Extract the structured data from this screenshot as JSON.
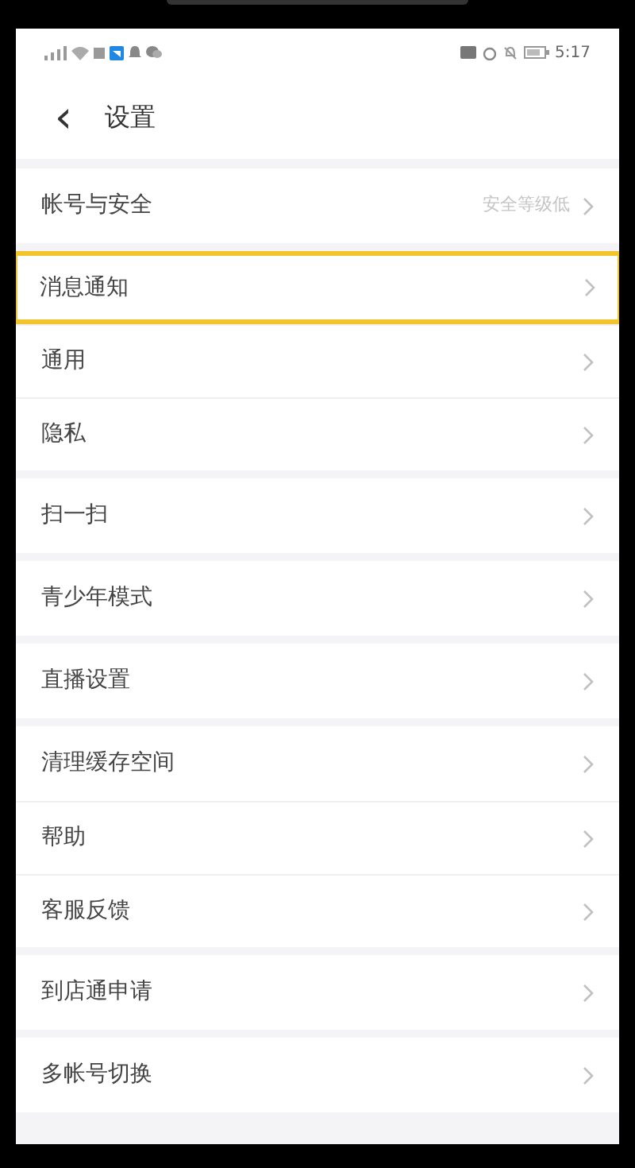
{
  "status_bar": {
    "time": "5:17"
  },
  "header": {
    "back": "‹",
    "title": "设置"
  },
  "groups": [
    {
      "items": [
        {
          "label": "帐号与安全",
          "value": "安全等级低",
          "selected": false
        }
      ]
    },
    {
      "items": [
        {
          "label": "消息通知",
          "selected": true
        },
        {
          "label": "通用",
          "selected": false
        },
        {
          "label": "隐私",
          "selected": false
        }
      ]
    },
    {
      "items": [
        {
          "label": "扫一扫",
          "selected": false
        }
      ]
    },
    {
      "items": [
        {
          "label": "青少年模式",
          "selected": false
        }
      ]
    },
    {
      "items": [
        {
          "label": "直播设置",
          "selected": false
        }
      ]
    },
    {
      "items": [
        {
          "label": "清理缓存空间",
          "selected": false
        },
        {
          "label": "帮助",
          "selected": false
        },
        {
          "label": "客服反馈",
          "selected": false
        }
      ]
    },
    {
      "items": [
        {
          "label": "到店通申请",
          "selected": false
        }
      ]
    },
    {
      "items": [
        {
          "label": "多帐号切换",
          "selected": false
        }
      ]
    }
  ]
}
